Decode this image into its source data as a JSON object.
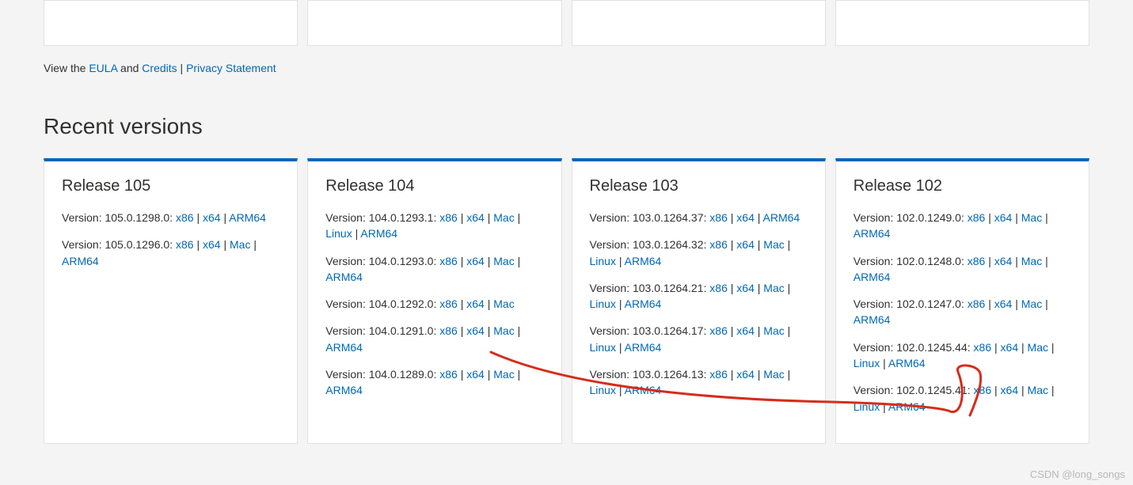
{
  "legal": {
    "prefix": "View the ",
    "eula": "EULA",
    "and": " and ",
    "credits": "Credits",
    "pipe": " | ",
    "privacy": "Privacy Statement"
  },
  "section_title": "Recent versions",
  "link_labels": {
    "x86": "x86",
    "x64": "x64",
    "mac": "Mac",
    "linux": "Linux",
    "arm64": "ARM64"
  },
  "releases": [
    {
      "title": "Release 105",
      "versions": [
        {
          "version": "105.0.1298.0",
          "links": [
            "x86",
            "x64",
            "arm64"
          ]
        },
        {
          "version": "105.0.1296.0",
          "links": [
            "x86",
            "x64",
            "mac",
            "arm64"
          ]
        }
      ]
    },
    {
      "title": "Release 104",
      "versions": [
        {
          "version": "104.0.1293.1",
          "links": [
            "x86",
            "x64",
            "mac",
            "linux",
            "arm64"
          ]
        },
        {
          "version": "104.0.1293.0",
          "links": [
            "x86",
            "x64",
            "mac",
            "arm64"
          ]
        },
        {
          "version": "104.0.1292.0",
          "links": [
            "x86",
            "x64",
            "mac"
          ]
        },
        {
          "version": "104.0.1291.0",
          "links": [
            "x86",
            "x64",
            "mac",
            "arm64"
          ]
        },
        {
          "version": "104.0.1289.0",
          "links": [
            "x86",
            "x64",
            "mac",
            "arm64"
          ]
        }
      ]
    },
    {
      "title": "Release 103",
      "versions": [
        {
          "version": "103.0.1264.37",
          "links": [
            "x86",
            "x64",
            "arm64"
          ]
        },
        {
          "version": "103.0.1264.32",
          "links": [
            "x86",
            "x64",
            "mac",
            "linux",
            "arm64"
          ]
        },
        {
          "version": "103.0.1264.21",
          "links": [
            "x86",
            "x64",
            "mac",
            "linux",
            "arm64"
          ]
        },
        {
          "version": "103.0.1264.17",
          "links": [
            "x86",
            "x64",
            "mac",
            "linux",
            "arm64"
          ]
        },
        {
          "version": "103.0.1264.13",
          "links": [
            "x86",
            "x64",
            "mac",
            "linux",
            "arm64"
          ]
        }
      ]
    },
    {
      "title": "Release 102",
      "versions": [
        {
          "version": "102.0.1249.0",
          "links": [
            "x86",
            "x64",
            "mac",
            "arm64"
          ]
        },
        {
          "version": "102.0.1248.0",
          "links": [
            "x86",
            "x64",
            "mac",
            "arm64"
          ]
        },
        {
          "version": "102.0.1247.0",
          "links": [
            "x86",
            "x64",
            "mac",
            "arm64"
          ]
        },
        {
          "version": "102.0.1245.44",
          "links": [
            "x86",
            "x64",
            "mac",
            "linux",
            "arm64"
          ]
        },
        {
          "version": "102.0.1245.41",
          "links": [
            "x86",
            "x64",
            "mac",
            "linux",
            "arm64"
          ]
        }
      ]
    }
  ],
  "watermark": "CSDN @long_songs"
}
